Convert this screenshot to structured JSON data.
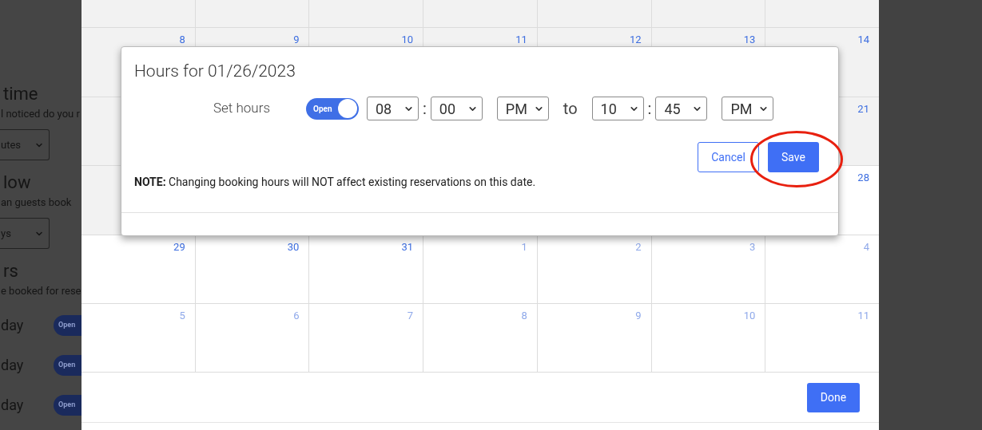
{
  "background_page": {
    "sections": [
      {
        "heading": "time",
        "description": "l noticed do you r",
        "select_value": "utes"
      },
      {
        "heading": "low",
        "description": "an guests book",
        "select_value": "ys"
      },
      {
        "heading": "rs",
        "description": "e booked for rese"
      }
    ],
    "day_rows": [
      {
        "label": "day",
        "toggle_label": "Open",
        "on": true
      },
      {
        "label": "day",
        "toggle_label": "Open",
        "on": true
      },
      {
        "label": "day",
        "toggle_label": "Open",
        "on": true
      }
    ]
  },
  "calendar": {
    "weeks": [
      {
        "days": [
          {
            "past": true
          },
          {
            "past": true
          },
          {
            "past": true
          },
          {
            "past": true
          },
          {
            "past": true
          },
          {
            "past": true
          },
          {
            "past": true
          }
        ]
      },
      {
        "days": [
          {
            "label": "8",
            "past": true,
            "muted": false
          },
          {
            "label": "9",
            "past": true,
            "muted": false
          },
          {
            "label": "10",
            "past": true,
            "muted": false
          },
          {
            "label": "11",
            "past": true,
            "muted": false
          },
          {
            "label": "12",
            "past": true,
            "muted": false
          },
          {
            "label": "13",
            "past": true,
            "muted": false
          },
          {
            "label": "14",
            "past": true,
            "muted": false
          }
        ]
      },
      {
        "days": [
          {
            "past": true
          },
          {
            "label": "21",
            "past": true,
            "muted": false
          }
        ]
      },
      {
        "days": [
          {
            "past": true
          },
          {
            "label": "28",
            "past": false,
            "muted": false
          }
        ]
      },
      {
        "days": [
          {
            "label": "29",
            "past": false,
            "muted": false
          },
          {
            "label": "30",
            "past": false,
            "muted": false
          },
          {
            "label": "31",
            "past": false,
            "muted": false
          },
          {
            "label": "1",
            "past": false,
            "muted": true
          },
          {
            "label": "2",
            "past": false,
            "muted": true
          },
          {
            "label": "3",
            "past": false,
            "muted": true
          },
          {
            "label": "4",
            "past": false,
            "muted": true
          }
        ]
      },
      {
        "days": [
          {
            "label": "5",
            "past": false,
            "muted": true
          },
          {
            "label": "6",
            "past": false,
            "muted": true
          },
          {
            "label": "7",
            "past": false,
            "muted": true
          },
          {
            "label": "8",
            "past": false,
            "muted": true
          },
          {
            "label": "9",
            "past": false,
            "muted": true
          },
          {
            "label": "10",
            "past": false,
            "muted": true
          },
          {
            "label": "11",
            "past": false,
            "muted": true
          }
        ]
      }
    ],
    "done_button": "Done"
  },
  "dialog": {
    "title": "Hours for 01/26/2023",
    "set_hours_label": "Set hours",
    "toggle": {
      "label": "Open",
      "on": true
    },
    "start": {
      "hour": "08",
      "separator": ":",
      "minute": "00",
      "period": "PM"
    },
    "to_label": "to",
    "end": {
      "hour": "10",
      "separator": ":",
      "minute": "45",
      "period": "PM"
    },
    "cancel_button": "Cancel",
    "save_button": "Save",
    "highlighted": true,
    "note": "**NOTE:** Changing booking hours will NOT affect existing reservations on this date."
  }
}
